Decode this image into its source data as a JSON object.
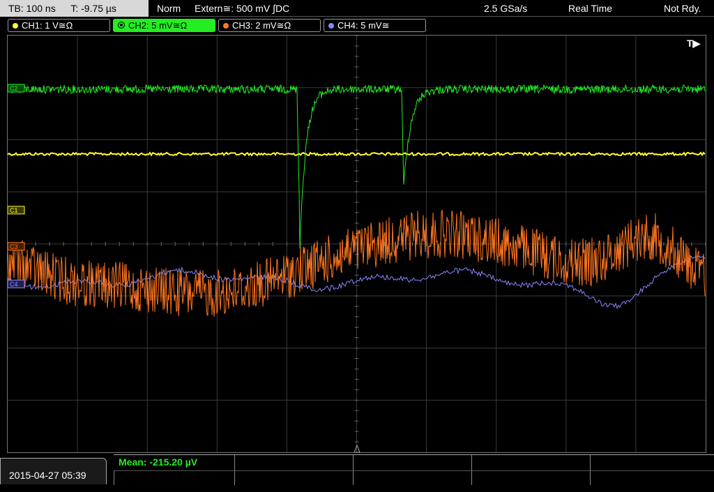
{
  "top_left": {
    "timebase": "TB: 100 ns",
    "trigger_time": "T: -9.75 µs"
  },
  "top_bar": {
    "mode": "Norm",
    "trigger_source": "Extern≅: 500 mV ∫DC",
    "sample_rate": "2.5 GSa/s",
    "acquisition": "Real Time",
    "status": "Not Rdy."
  },
  "channels": [
    {
      "label": "CH1: 1 V≅Ω",
      "color": "#ffff33",
      "active": false
    },
    {
      "label": "CH2: 5 mV≅Ω",
      "color": "#22ee22",
      "active": true
    },
    {
      "label": "CH3: 2 mV≅Ω",
      "color": "#ff7722",
      "active": false
    },
    {
      "label": "CH4: 5 mV≅",
      "color": "#8888ff",
      "active": false
    }
  ],
  "markers": {
    "c1": "C1",
    "c2": "C2",
    "c3": "C3",
    "c4": "C4",
    "trigger": "T▶"
  },
  "colors": {
    "ch1": "#ffff33",
    "ch2": "#22ee22",
    "ch3": "#ff7722",
    "ch4": "#8888ff",
    "grid": "#3a3a3a"
  },
  "footer": {
    "datetime": "2015-04-27 05:39",
    "measurement": "Mean: -215.20 µV"
  }
}
